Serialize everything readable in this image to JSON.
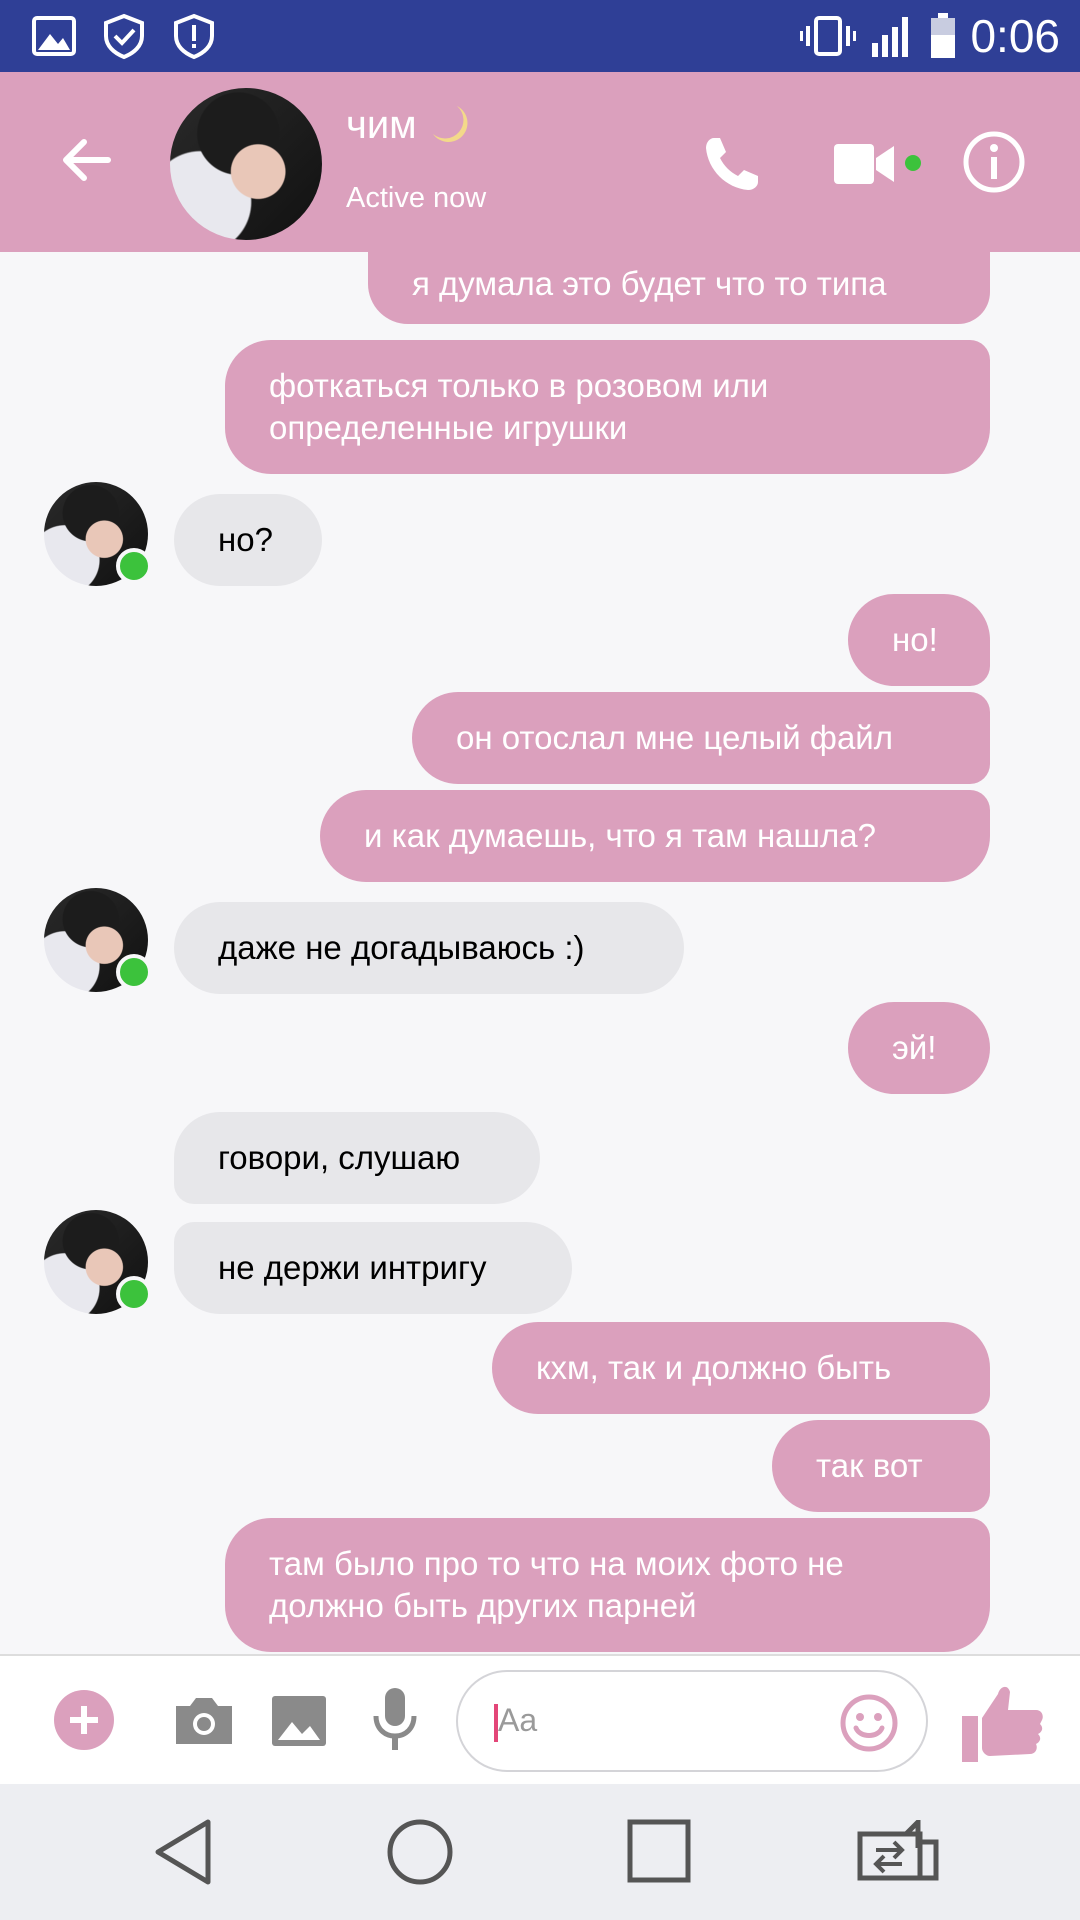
{
  "status_bar": {
    "time": "0:06",
    "icons": [
      "image-icon",
      "shield-check-icon",
      "shield-alert-icon",
      "vibrate-icon",
      "signal-icon",
      "battery-icon"
    ]
  },
  "header": {
    "contact_name": "чим",
    "status": "Active now",
    "icons": [
      "back-arrow-icon",
      "moon-emoji-icon",
      "phone-icon",
      "video-camera-icon",
      "info-icon"
    ],
    "accent_color": "#dba0bd"
  },
  "messages": [
    {
      "side": "out",
      "text": "я думала это будет что то типа"
    },
    {
      "side": "out",
      "text": "фоткаться только в розовом или определенные игрушки"
    },
    {
      "side": "in",
      "text": "но?"
    },
    {
      "side": "out",
      "text": "но!"
    },
    {
      "side": "out",
      "text": "он отослал мне целый файл"
    },
    {
      "side": "out",
      "text": "и как думаешь, что я там нашла?"
    },
    {
      "side": "in",
      "text": "даже не догадываюсь :)"
    },
    {
      "side": "out",
      "text": "эй!"
    },
    {
      "side": "in",
      "text": "говори, слушаю"
    },
    {
      "side": "in",
      "text": "не держи интригу"
    },
    {
      "side": "out",
      "text": "кхм, так и должно быть"
    },
    {
      "side": "out",
      "text": "так вот"
    },
    {
      "side": "out",
      "text": "там было про то что на моих фото не должно быть других парней"
    }
  ],
  "composer": {
    "placeholder": "Aa",
    "icons": [
      "plus-icon",
      "camera-icon",
      "gallery-icon",
      "microphone-icon",
      "emoji-icon",
      "thumbs-up-icon"
    ]
  },
  "nav_bar": {
    "icons": [
      "nav-back-icon",
      "nav-home-icon",
      "nav-recents-icon",
      "nav-switch-icon"
    ]
  },
  "colors": {
    "status_bar": "#2f3f96",
    "outgoing_bubble": "#dba0bd",
    "incoming_bubble": "#e7e7ea",
    "online": "#3cc23c"
  }
}
